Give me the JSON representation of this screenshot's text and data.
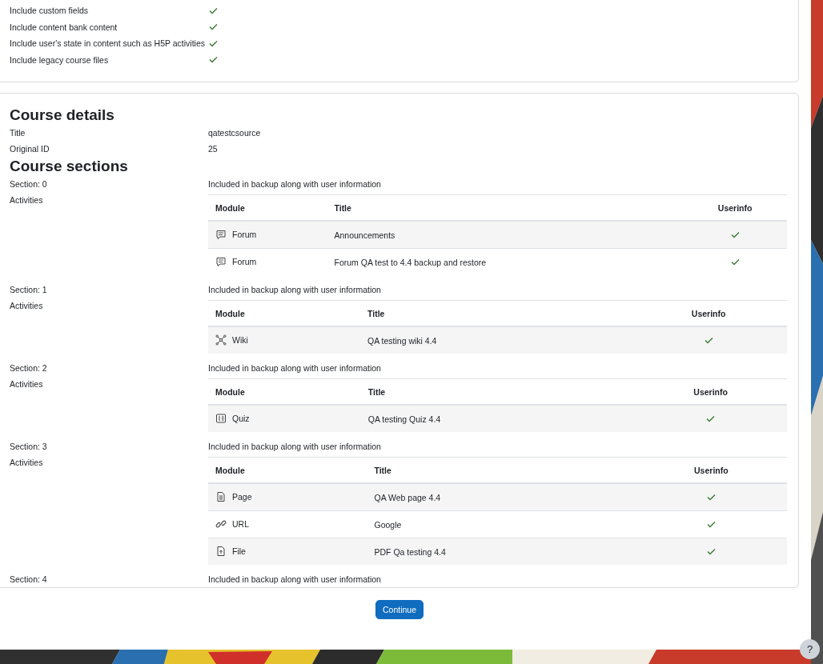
{
  "settings": [
    {
      "label": "Include custom fields",
      "included": true
    },
    {
      "label": "Include content bank content",
      "included": true
    },
    {
      "label": "Include user's state in content such as H5P activities",
      "included": true
    },
    {
      "label": "Include legacy course files",
      "included": true
    }
  ],
  "course_details": {
    "heading": "Course details",
    "fields": [
      {
        "label": "Title",
        "value": "qatestcsource"
      },
      {
        "label": "Original ID",
        "value": "25"
      }
    ]
  },
  "course_sections": {
    "heading": "Course sections",
    "sections": [
      {
        "label": "Section: 0",
        "status": "Included in backup along with user information",
        "activities_label": "Activities",
        "columns": [
          "Module",
          "Title",
          "Userinfo"
        ],
        "activities": [
          {
            "kind": "forum",
            "module": "Forum",
            "title": "Announcements",
            "userinfo": true
          },
          {
            "kind": "forum",
            "module": "Forum",
            "title": "Forum QA test to 4.4 backup and restore",
            "userinfo": true
          }
        ]
      },
      {
        "label": "Section: 1",
        "status": "Included in backup along with user information",
        "activities_label": "Activities",
        "columns": [
          "Module",
          "Title",
          "Userinfo"
        ],
        "activities": [
          {
            "kind": "wiki",
            "module": "Wiki",
            "title": "QA testing wiki 4.4",
            "userinfo": true
          }
        ]
      },
      {
        "label": "Section: 2",
        "status": "Included in backup along with user information",
        "activities_label": "Activities",
        "columns": [
          "Module",
          "Title",
          "Userinfo"
        ],
        "activities": [
          {
            "kind": "quiz",
            "module": "Quiz",
            "title": "QA testing Quiz 4.4",
            "userinfo": true
          }
        ]
      },
      {
        "label": "Section: 3",
        "status": "Included in backup along with user information",
        "activities_label": "Activities",
        "columns": [
          "Module",
          "Title",
          "Userinfo"
        ],
        "activities": [
          {
            "kind": "page",
            "module": "Page",
            "title": "QA Web page 4.4",
            "userinfo": true
          },
          {
            "kind": "url",
            "module": "URL",
            "title": "Google",
            "userinfo": true
          },
          {
            "kind": "file",
            "module": "File",
            "title": "PDF Qa testing 4.4",
            "userinfo": true
          }
        ]
      },
      {
        "label": "Section: 4",
        "status": "Included in backup along with user information"
      }
    ]
  },
  "continue_button": "Continue",
  "help_button": "?"
}
